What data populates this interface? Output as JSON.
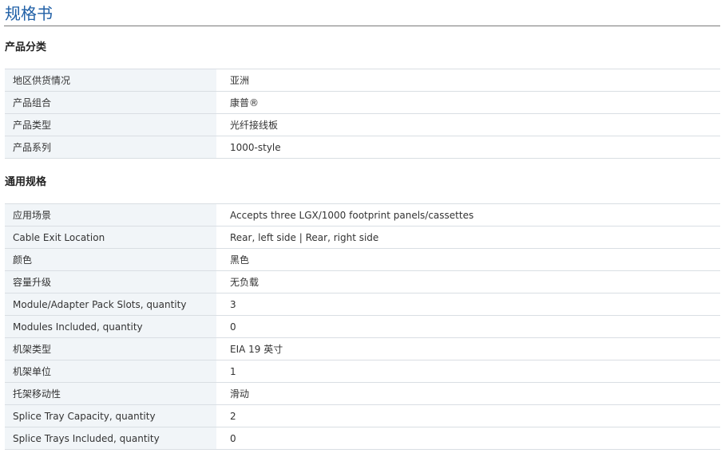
{
  "page_title": "规格书",
  "sections": [
    {
      "heading": "产品分类",
      "rows": [
        {
          "label": "地区供货情况",
          "value": "亚洲"
        },
        {
          "label": "产品组合",
          "value": "康普®"
        },
        {
          "label": "产品类型",
          "value": "光纤接线板"
        },
        {
          "label": "产品系列",
          "value": "1000-style"
        }
      ]
    },
    {
      "heading": "通用规格",
      "rows": [
        {
          "label": "应用场景",
          "value": "Accepts three LGX/1000 footprint panels/cassettes"
        },
        {
          "label": "Cable Exit Location",
          "value": "Rear, left side | Rear, right side"
        },
        {
          "label": "颜色",
          "value": "黑色"
        },
        {
          "label": "容量升级",
          "value": "无负载"
        },
        {
          "label": "Module/Adapter Pack Slots, quantity",
          "value": "3"
        },
        {
          "label": "Modules Included, quantity",
          "value": "0"
        },
        {
          "label": "机架类型",
          "value": "EIA 19 英寸"
        },
        {
          "label": "机架单位",
          "value": "1"
        },
        {
          "label": "托架移动性",
          "value": "滑动"
        },
        {
          "label": "Splice Tray Capacity, quantity",
          "value": "2"
        },
        {
          "label": "Splice Trays Included, quantity",
          "value": "0"
        }
      ]
    }
  ],
  "colors": {
    "title": "#1f5fa6",
    "label_background": "#f1f5f8",
    "row_border": "#d9dee3"
  }
}
